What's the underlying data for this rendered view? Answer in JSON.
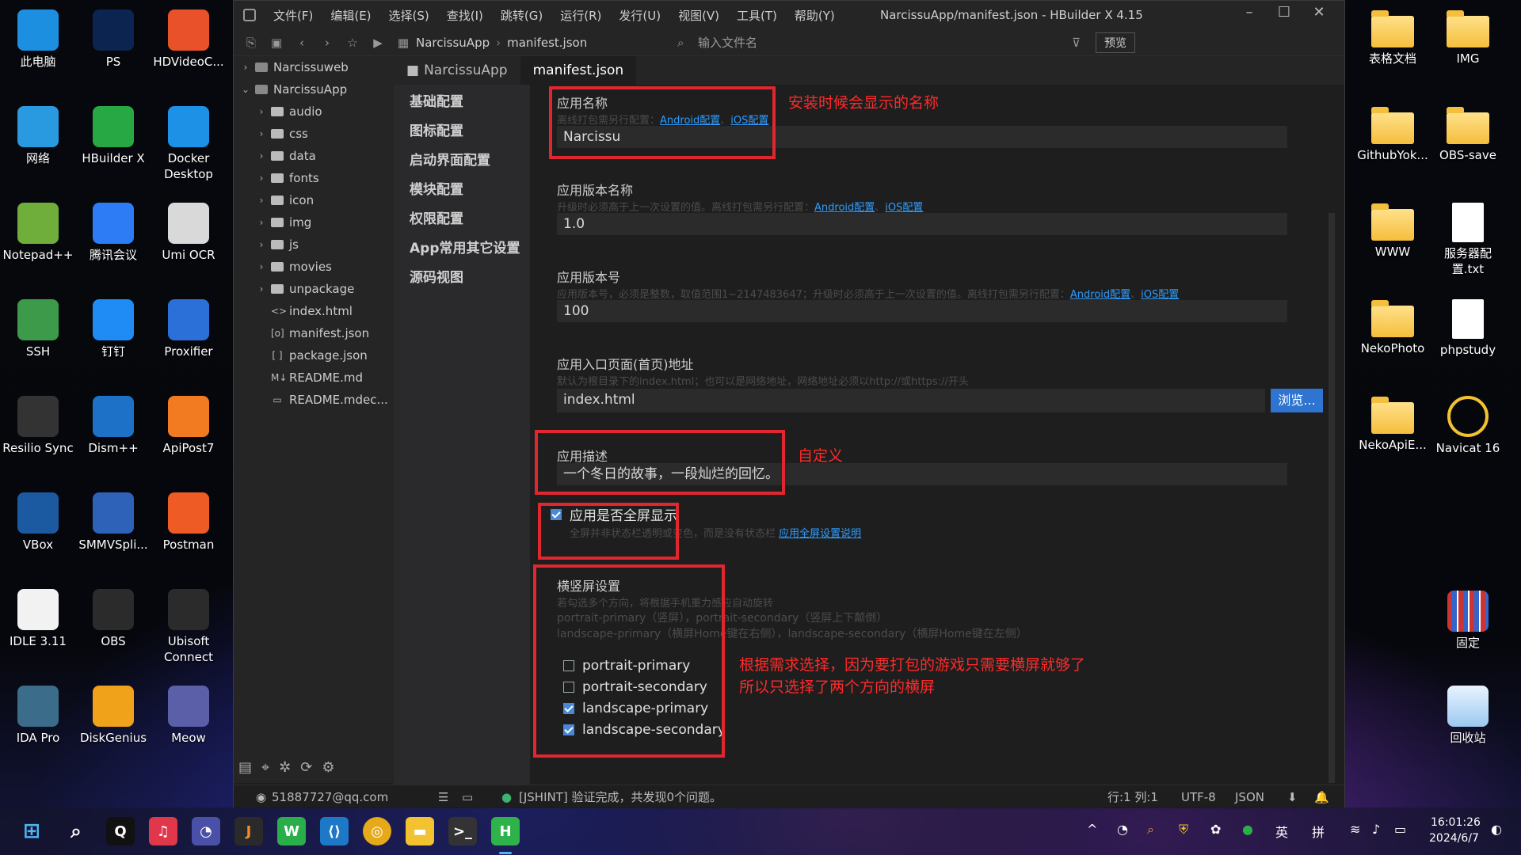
{
  "desktop_left": [
    {
      "label": "此电脑",
      "icon": "computer-icon",
      "color": "#1d8fe0"
    },
    {
      "label": "PS",
      "icon": "photoshop-icon",
      "color": "#0b2550"
    },
    {
      "label": "HDVideoC...",
      "icon": "hdvideo-icon",
      "color": "#e8512a"
    },
    {
      "label": "网络",
      "icon": "network-icon",
      "color": "#2a9ae0"
    },
    {
      "label": "HBuilder X",
      "icon": "hbuilder-icon",
      "color": "#28a745"
    },
    {
      "label": "Docker Desktop",
      "icon": "docker-icon",
      "color": "#1d91e6"
    },
    {
      "label": "Notepad++",
      "icon": "notepad-icon",
      "color": "#6fae3a"
    },
    {
      "label": "腾讯会议",
      "icon": "tencent-meeting-icon",
      "color": "#2d7cf6"
    },
    {
      "label": "Umi OCR",
      "icon": "umi-ocr-icon",
      "color": "#d9d9d9"
    },
    {
      "label": "SSH",
      "icon": "ssh-icon",
      "color": "#3c9a4a"
    },
    {
      "label": "钉钉",
      "icon": "dingtalk-icon",
      "color": "#1f8cf5"
    },
    {
      "label": "Proxifier",
      "icon": "proxifier-icon",
      "color": "#2b6fd8"
    },
    {
      "label": "Resilio Sync",
      "icon": "resilio-icon",
      "color": "#333333"
    },
    {
      "label": "Dism++",
      "icon": "dism-icon",
      "color": "#1d72c8"
    },
    {
      "label": "ApiPost7",
      "icon": "apipost-icon",
      "color": "#f27b22"
    },
    {
      "label": "VBox",
      "icon": "virtualbox-icon",
      "color": "#1b5aa0"
    },
    {
      "label": "SMMVSpli...",
      "icon": "smmvsplit-icon",
      "color": "#2e62b8"
    },
    {
      "label": "Postman",
      "icon": "postman-icon",
      "color": "#ef5b25"
    },
    {
      "label": "IDLE 3.11",
      "icon": "python-icon",
      "color": "#f2f2f2"
    },
    {
      "label": "OBS",
      "icon": "obs-icon",
      "color": "#2b2b2b"
    },
    {
      "label": "Ubisoft Connect",
      "icon": "ubisoft-icon",
      "color": "#2b2b2b"
    },
    {
      "label": "IDA Pro",
      "icon": "ida-icon",
      "color": "#3b6c8a"
    },
    {
      "label": "DiskGenius",
      "icon": "diskgenius-icon",
      "color": "#f0a21a"
    },
    {
      "label": "Meow",
      "icon": "meow-icon",
      "color": "#5b5fa8"
    }
  ],
  "desktop_right": [
    {
      "label": "表格文档",
      "icon": "folder-icon"
    },
    {
      "label": "IMG",
      "icon": "folder-icon"
    },
    {
      "label": "GithubYok...",
      "icon": "folder-icon"
    },
    {
      "label": "OBS-save",
      "icon": "folder-icon"
    },
    {
      "label": "WWW",
      "icon": "folder-icon"
    },
    {
      "label": "服务器配置.txt",
      "icon": "text-file-icon"
    },
    {
      "label": "NekoPhoto",
      "icon": "folder-icon"
    },
    {
      "label": "phpstudy",
      "icon": "text-file-icon"
    },
    {
      "label": "NekoApiE...",
      "icon": "folder-icon"
    },
    {
      "label": "Navicat 16",
      "icon": "navicat-icon"
    },
    {
      "label": "固定",
      "icon": "pinned-app-icon"
    },
    {
      "label": "回收站",
      "icon": "recycle-bin-icon"
    }
  ],
  "window": {
    "title": "NarcissuApp/manifest.json - HBuilder X 4.15",
    "menu": [
      "文件(F)",
      "编辑(E)",
      "选择(S)",
      "查找(I)",
      "跳转(G)",
      "运行(R)",
      "发行(U)",
      "视图(V)",
      "工具(T)",
      "帮助(Y)"
    ],
    "breadcrumb": [
      "NarcissuApp",
      "manifest.json"
    ],
    "file_search_placeholder": "输入文件名",
    "preview": "预览"
  },
  "tree": [
    {
      "label": "Narcissuweb",
      "level": 0,
      "type": "project",
      "chevron": "›"
    },
    {
      "label": "NarcissuApp",
      "level": 0,
      "type": "project",
      "chevron": "⌄"
    },
    {
      "label": "audio",
      "level": 1,
      "type": "folder",
      "chevron": "›"
    },
    {
      "label": "css",
      "level": 1,
      "type": "folder",
      "chevron": "›"
    },
    {
      "label": "data",
      "level": 1,
      "type": "folder",
      "chevron": "›"
    },
    {
      "label": "fonts",
      "level": 1,
      "type": "folder",
      "chevron": "›"
    },
    {
      "label": "icon",
      "level": 1,
      "type": "folder",
      "chevron": "›"
    },
    {
      "label": "img",
      "level": 1,
      "type": "folder",
      "chevron": "›"
    },
    {
      "label": "js",
      "level": 1,
      "type": "folder",
      "chevron": "›"
    },
    {
      "label": "movies",
      "level": 1,
      "type": "folder",
      "chevron": "›"
    },
    {
      "label": "unpackage",
      "level": 1,
      "type": "folder",
      "chevron": "›"
    },
    {
      "label": "index.html",
      "level": 1,
      "type": "file",
      "glyph": "<>"
    },
    {
      "label": "manifest.json",
      "level": 1,
      "type": "file",
      "glyph": "[o]"
    },
    {
      "label": "package.json",
      "level": 1,
      "type": "file",
      "glyph": "[ ]"
    },
    {
      "label": "README.md",
      "level": 1,
      "type": "file",
      "glyph": "M↓"
    },
    {
      "label": "README.mdec...",
      "level": 1,
      "type": "file",
      "glyph": "▭"
    }
  ],
  "tabs": [
    "NarcissuApp",
    "manifest.json"
  ],
  "nav": [
    "基础配置",
    "图标配置",
    "启动界面配置",
    "模块配置",
    "权限配置",
    "App常用其它设置",
    "源码视图"
  ],
  "form": {
    "name_label": "应用名称",
    "name_hint_prefix": "离线打包需另行配置：",
    "android": "Android配置",
    "sep": "、",
    "ios": "iOS配置",
    "name_value": "Narcissu",
    "version_name_label": "应用版本名称",
    "version_name_hint": "升级时必须高于上一次设置的值。离线打包需另行配置：",
    "version_name_value": "1.0",
    "version_code_label": "应用版本号",
    "version_code_hint": "应用版本号，必须是整数，取值范围1~2147483647；升级时必须高于上一次设置的值。离线打包需另行配置：",
    "version_code_value": "100",
    "entry_label": "应用入口页面(首页)地址",
    "entry_hint": "默认为根目录下的index.html；也可以是网络地址，网络地址必须以http://或https://开头",
    "entry_value": "index.html",
    "browse": "浏览...",
    "desc_label": "应用描述",
    "desc_value": "一个冬日的故事，一段灿烂的回忆。",
    "fullscreen_label": "应用是否全屏显示",
    "fullscreen_checked": true,
    "fullscreen_hint": "全屏并非状态栏透明或变色，而是没有状态栏",
    "fullscreen_link": "应用全屏设置说明",
    "orientation_label": "横竖屏设置",
    "orientation_hint1": "若勾选多个方向，将根据手机重力感应自动旋转",
    "orientation_hint2": "portrait-primary（竖屏），portrait-secondary（竖屏上下颠倒）",
    "orientation_hint3": "landscape-primary（横屏Home键在右侧），landscape-secondary（横屏Home键在左侧）",
    "orientations": [
      {
        "label": "portrait-primary",
        "checked": false
      },
      {
        "label": "portrait-secondary",
        "checked": false
      },
      {
        "label": "landscape-primary",
        "checked": true
      },
      {
        "label": "landscape-secondary",
        "checked": true
      }
    ]
  },
  "annotations": {
    "name": "安装时候会显示的名称",
    "desc": "自定义",
    "orientation_line1": "根据需求选择，因为要打包的游戏只需要横屏就够了",
    "orientation_line2": "所以只选择了两个方向的横屏"
  },
  "status": {
    "account": "51887727@qq.com",
    "message": "[JSHINT] 验证完成，共发现0个问题。",
    "position": "行:1  列:1",
    "encoding": "UTF-8",
    "language": "JSON"
  },
  "taskbar": {
    "ime1": "英",
    "ime2": "拼",
    "time": "16:01:26",
    "date": "2024/6/7"
  }
}
